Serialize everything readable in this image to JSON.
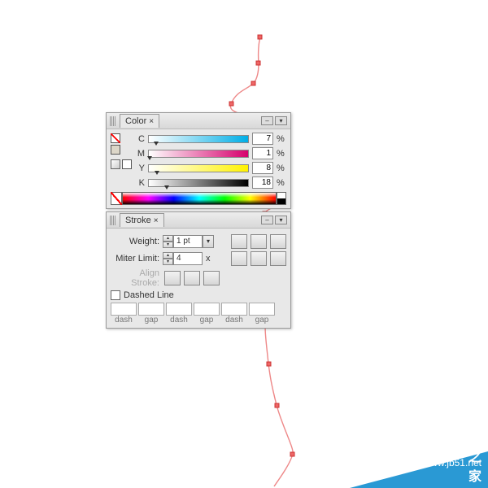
{
  "color_panel": {
    "title": "Color",
    "channels": [
      {
        "label": "C",
        "value": "7",
        "unit": "%",
        "gradient": "linear-gradient(to right,#fff,#00aee6)"
      },
      {
        "label": "M",
        "value": "1",
        "unit": "%",
        "gradient": "linear-gradient(to right,#fff,#d6006c)"
      },
      {
        "label": "Y",
        "value": "8",
        "unit": "%",
        "gradient": "linear-gradient(to right,#fff,#fff200)"
      },
      {
        "label": "K",
        "value": "18",
        "unit": "%",
        "gradient": "linear-gradient(to right,#fff,#000)"
      }
    ]
  },
  "stroke_panel": {
    "title": "Stroke",
    "weight_label": "Weight:",
    "weight_value": "1 pt",
    "miter_label": "Miter Limit:",
    "miter_value": "4",
    "miter_unit": "x",
    "align_label": "Align Stroke:",
    "dashed_label": "Dashed Line",
    "dash_labels": [
      "dash",
      "gap",
      "dash",
      "gap",
      "dash",
      "gap"
    ]
  },
  "watermark": {
    "url": "www.jb51.net",
    "text": "脚本之家"
  },
  "chart_data": {
    "type": "path",
    "description": "Freehand vector profile path on artboard with visible anchor points",
    "stroke_color": "#e57373",
    "points": [
      [
        320,
        46
      ],
      [
        317,
        57
      ],
      [
        318,
        78
      ],
      [
        312,
        102
      ],
      [
        295,
        116
      ],
      [
        284,
        128
      ],
      [
        296,
        139
      ],
      [
        316,
        148
      ],
      [
        327,
        153
      ],
      [
        328,
        164
      ],
      [
        320,
        177
      ],
      [
        318,
        190
      ],
      [
        330,
        200
      ],
      [
        328,
        210
      ],
      [
        320,
        220
      ],
      [
        315,
        232
      ],
      [
        335,
        240
      ],
      [
        342,
        247
      ],
      [
        330,
        256
      ],
      [
        325,
        262
      ],
      [
        326,
        284
      ],
      [
        330,
        314
      ],
      [
        334,
        350
      ],
      [
        328,
        381
      ],
      [
        327,
        417
      ],
      [
        330,
        447
      ],
      [
        333,
        470
      ],
      [
        340,
        498
      ],
      [
        352,
        530
      ],
      [
        360,
        558
      ],
      [
        352,
        582
      ],
      [
        337,
        598
      ]
    ]
  }
}
